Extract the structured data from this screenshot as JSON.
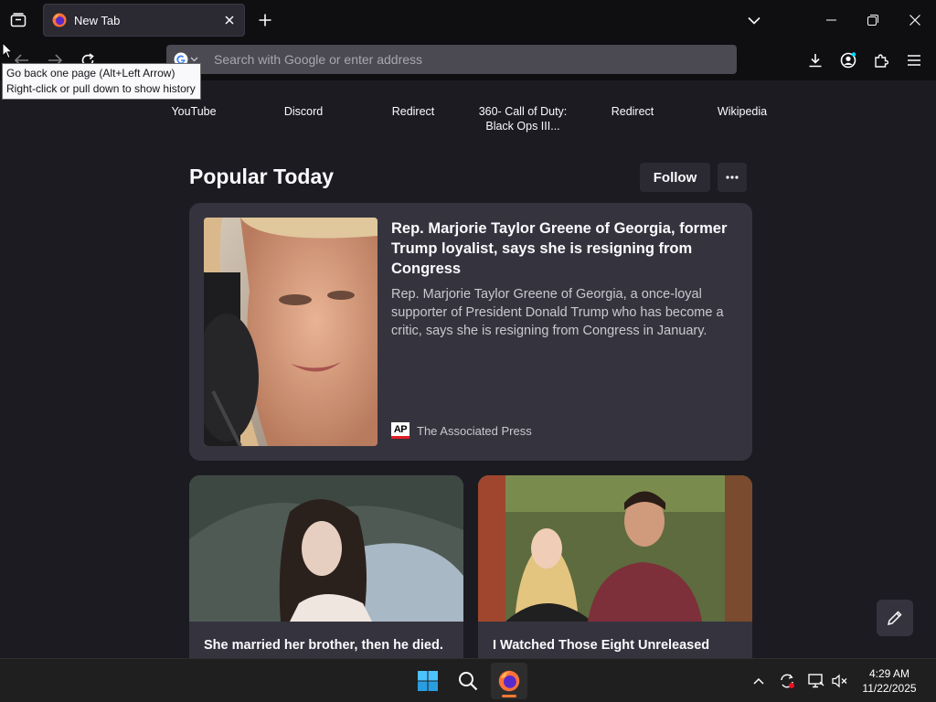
{
  "browser": {
    "tab": {
      "title": "New Tab"
    },
    "urlbar": {
      "placeholder": "Search with Google or enter address"
    },
    "tooltip": {
      "line1": "Go back one page (Alt+Left Arrow)",
      "line2": "Right-click or pull down to show history"
    }
  },
  "shortcuts": [
    {
      "label": "YouTube"
    },
    {
      "label": "Discord"
    },
    {
      "label": "Redirect"
    },
    {
      "label": "360- Call of Duty: Black Ops III..."
    },
    {
      "label": "Redirect"
    },
    {
      "label": "Wikipedia"
    }
  ],
  "feed": {
    "section_title": "Popular Today",
    "follow_label": "Follow",
    "hero": {
      "title": "Rep. Marjorie Taylor Greene of Georgia, former Trump loyalist, says she is resigning from Congress",
      "excerpt": "Rep. Marjorie Taylor Greene of Georgia, a once-loyal supporter of President Donald Trump who has become a critic, says she is resigning from Congress in January.",
      "source": "The Associated Press",
      "source_logo": "AP"
    },
    "cards": [
      {
        "title": "She married her brother, then he died."
      },
      {
        "title": "I Watched Those Eight Unreleased"
      }
    ]
  },
  "taskbar": {
    "time": "4:29 AM",
    "date": "11/22/2025"
  },
  "colors": {
    "accent_firefox": "#f47a35",
    "card_bg": "#35343e",
    "page_bg": "#1c1b22"
  }
}
